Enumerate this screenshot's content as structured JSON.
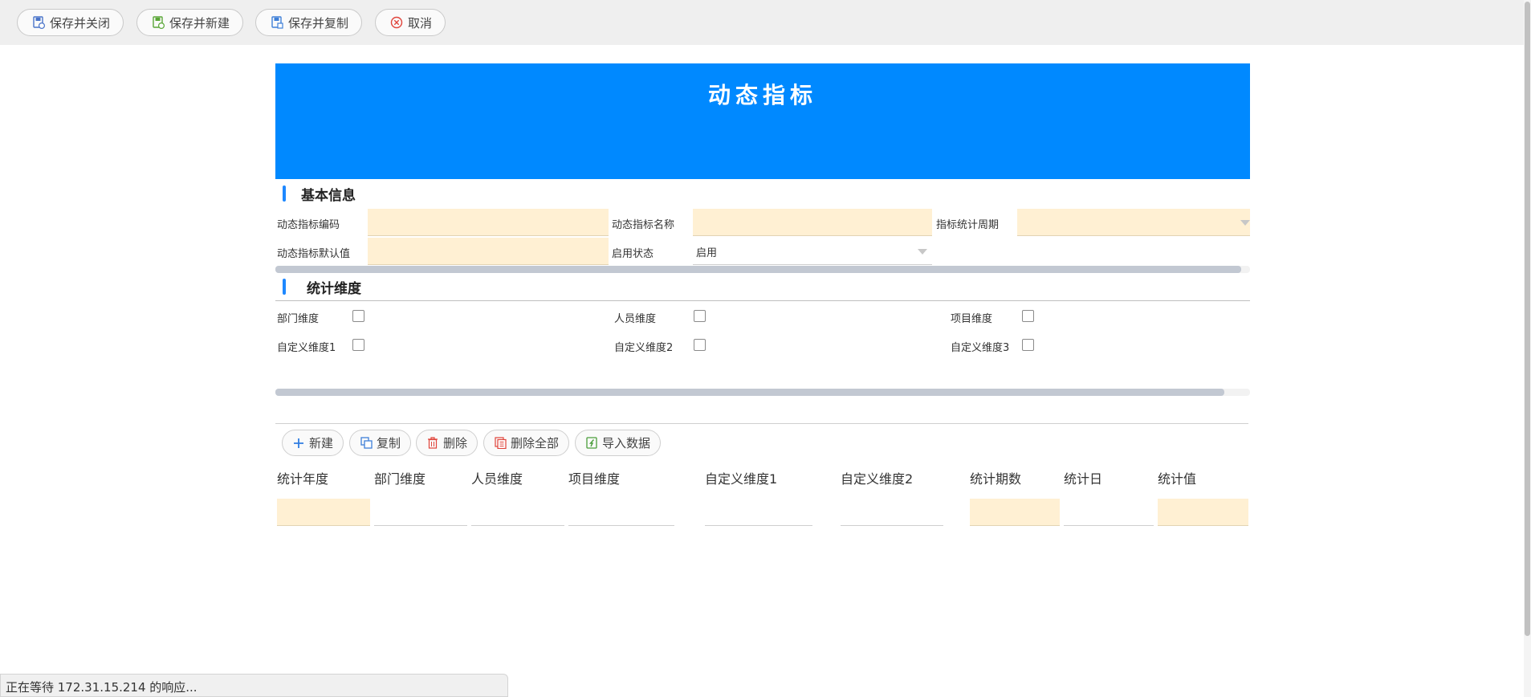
{
  "toolbar": {
    "buttons": [
      {
        "label": "保存并关闭",
        "icon": "save-close-icon"
      },
      {
        "label": "保存并新建",
        "icon": "save-new-icon"
      },
      {
        "label": "保存并复制",
        "icon": "save-copy-icon"
      },
      {
        "label": "取消",
        "icon": "cancel-icon"
      }
    ]
  },
  "banner": {
    "title": "动态指标"
  },
  "basic_info": {
    "title": "基本信息",
    "code_label": "动态指标编码",
    "name_label": "动态指标名称",
    "period_label": "指标统计周期",
    "default_label": "动态指标默认值",
    "status_label": "启用状态",
    "status_value": "启用"
  },
  "dimensions": {
    "title": "统计维度",
    "items": [
      {
        "label": "部门维度",
        "checked": false
      },
      {
        "label": "人员维度",
        "checked": false
      },
      {
        "label": "项目维度",
        "checked": false
      },
      {
        "label": "自定义维度1",
        "checked": false
      },
      {
        "label": "自定义维度2",
        "checked": false
      },
      {
        "label": "自定义维度3",
        "checked": false
      }
    ]
  },
  "grid": {
    "buttons": [
      {
        "label": "新建",
        "icon": "plus-icon"
      },
      {
        "label": "复制",
        "icon": "copy-icon"
      },
      {
        "label": "删除",
        "icon": "trash-icon"
      },
      {
        "label": "删除全部",
        "icon": "delete-all-icon"
      },
      {
        "label": "导入数据",
        "icon": "import-icon"
      }
    ],
    "columns": [
      "统计年度",
      "部门维度",
      "人员维度",
      "项目维度",
      "自定义维度1",
      "自定义维度2",
      "统计期数",
      "统计日",
      "统计值"
    ]
  },
  "status_bar": "正在等待 172.31.15.214 的响应...",
  "colors": {
    "banner": "#0089ff",
    "required_field": "#fff0d3",
    "accent": "#1e88ff"
  }
}
